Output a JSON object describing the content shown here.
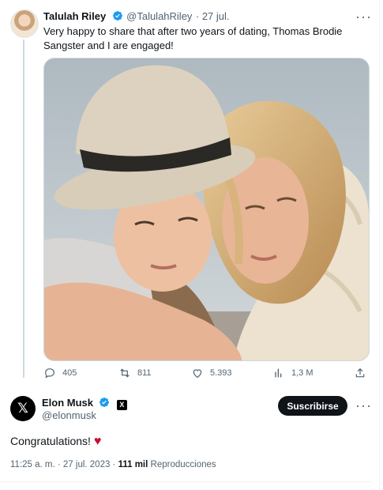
{
  "original_tweet": {
    "author_name": "Talulah Riley",
    "handle": "@TalulahRiley",
    "date": "· 27 jul.",
    "text": "Very happy to share that after two years of dating, Thomas Brodie Sangster and I are engaged!",
    "stats": {
      "replies": "405",
      "retweets": "811",
      "likes": "5.393",
      "views": "1,3 M"
    }
  },
  "reply_tweet": {
    "author_name": "Elon Musk",
    "handle": "@elonmusk",
    "subscribe_label": "Suscribirse",
    "text": "Congratulations!",
    "heart_glyph": "♥",
    "time": "11:25 a. m. · 27 jul. 2023 ·",
    "view_count": "111 mil",
    "views_label": "Reproducciones"
  },
  "colors": {
    "verified_blue": "#1d9bf0",
    "heart_red": "#c8102e",
    "muted_text": "#536471"
  },
  "icons": [
    "verified-badge-icon",
    "more-options-icon",
    "reply-icon",
    "retweet-icon",
    "like-icon",
    "views-icon",
    "share-icon",
    "x-logo-icon",
    "heart-icon"
  ]
}
